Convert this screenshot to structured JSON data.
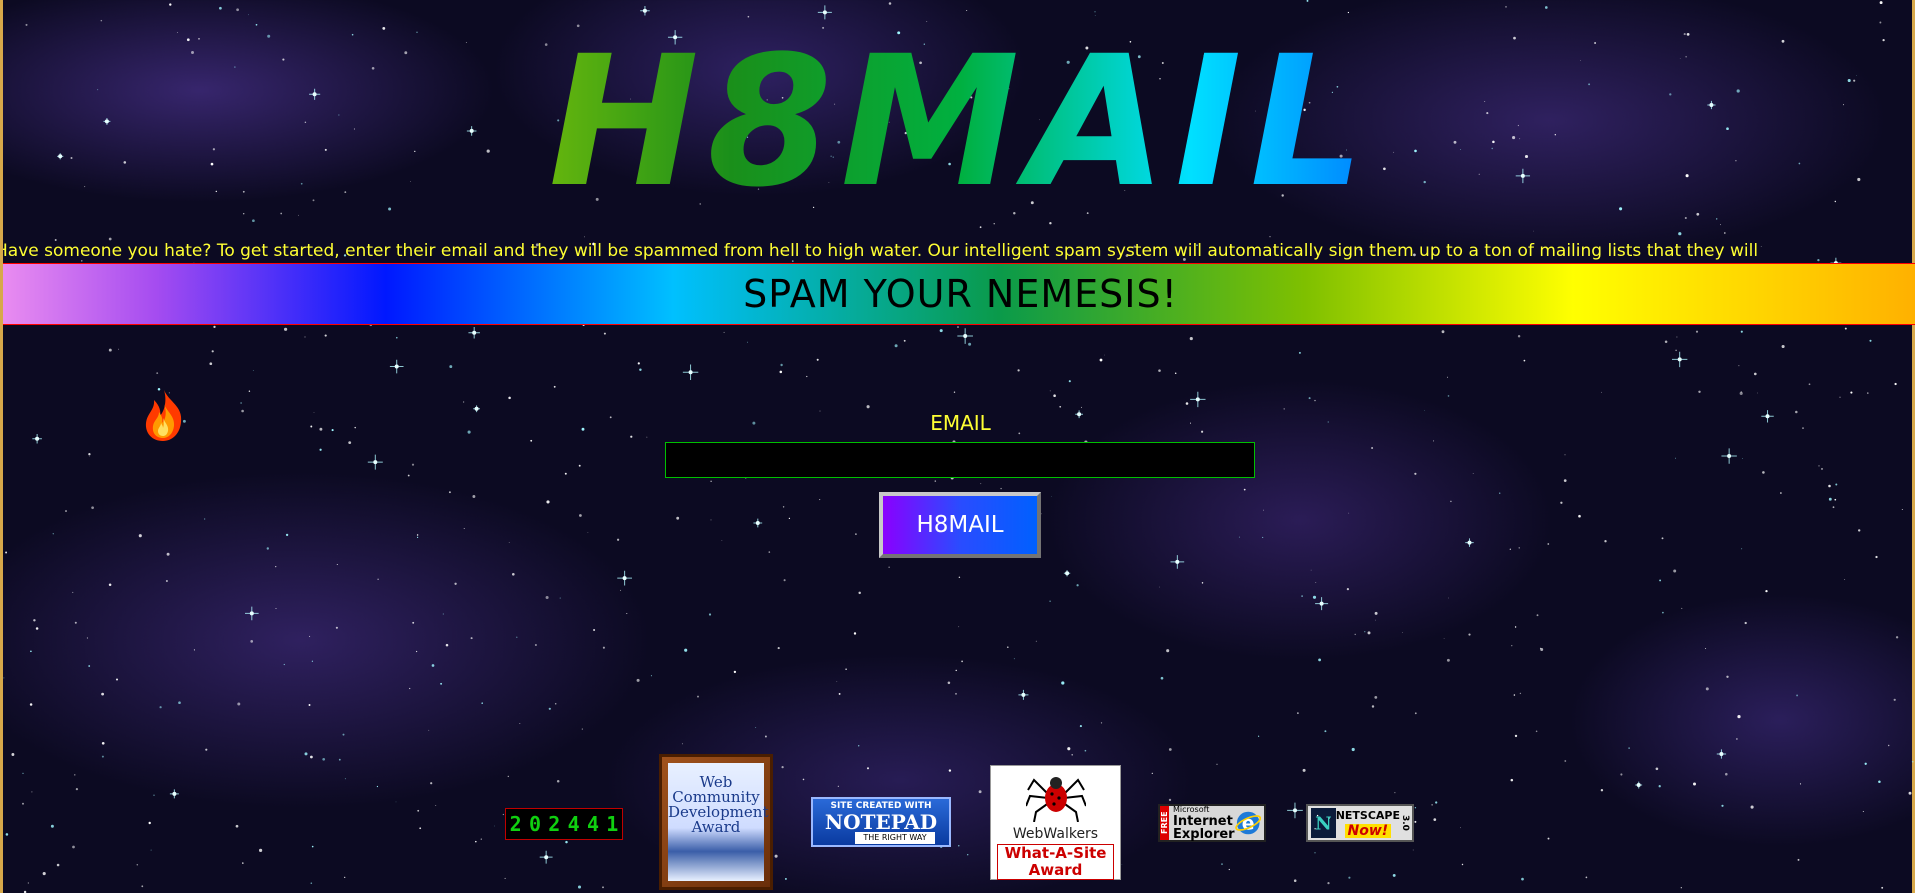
{
  "logo": {
    "text": "H8MAIL"
  },
  "marquee": {
    "text": "Have someone you hate? To get started, enter their email and they will be spammed from hell to high water. Our intelligent spam system will automatically sign them up to a ton of mailing lists that they will"
  },
  "banner": {
    "title": "SPAM YOUR NEMESIS!"
  },
  "form": {
    "email_label": "EMAIL",
    "email_value": "",
    "email_placeholder": "",
    "submit_label": "H8MAIL"
  },
  "footer": {
    "hit_counter_digits": [
      "2",
      "0",
      "2",
      "4",
      "4",
      "1"
    ],
    "award_wcd_lines": [
      "Web",
      "Community",
      "Development",
      "Award"
    ],
    "notepad_badge": {
      "line1": "SITE CREATED WITH",
      "line2": "NOTEPAD",
      "line3": "THE RIGHT WAY"
    },
    "webwalkers_award": {
      "brand": "WebWalkers",
      "line1": "What-A-Site",
      "line2": "Award"
    },
    "ie_badge": {
      "free": "FREE",
      "line1": "Microsoft",
      "line2": "Internet",
      "line3": "Explorer"
    },
    "netscape_badge": {
      "line1": "NETSCAPE",
      "line2": "Now!",
      "version": "3.0"
    }
  },
  "colors": {
    "marquee_text": "#ffff33",
    "email_label": "#ffff33",
    "input_border": "#00c000",
    "banner_border": "#ff0000"
  },
  "icons": [
    "flame-icon",
    "spider-icon",
    "ie-logo-icon",
    "netscape-logo-icon"
  ]
}
